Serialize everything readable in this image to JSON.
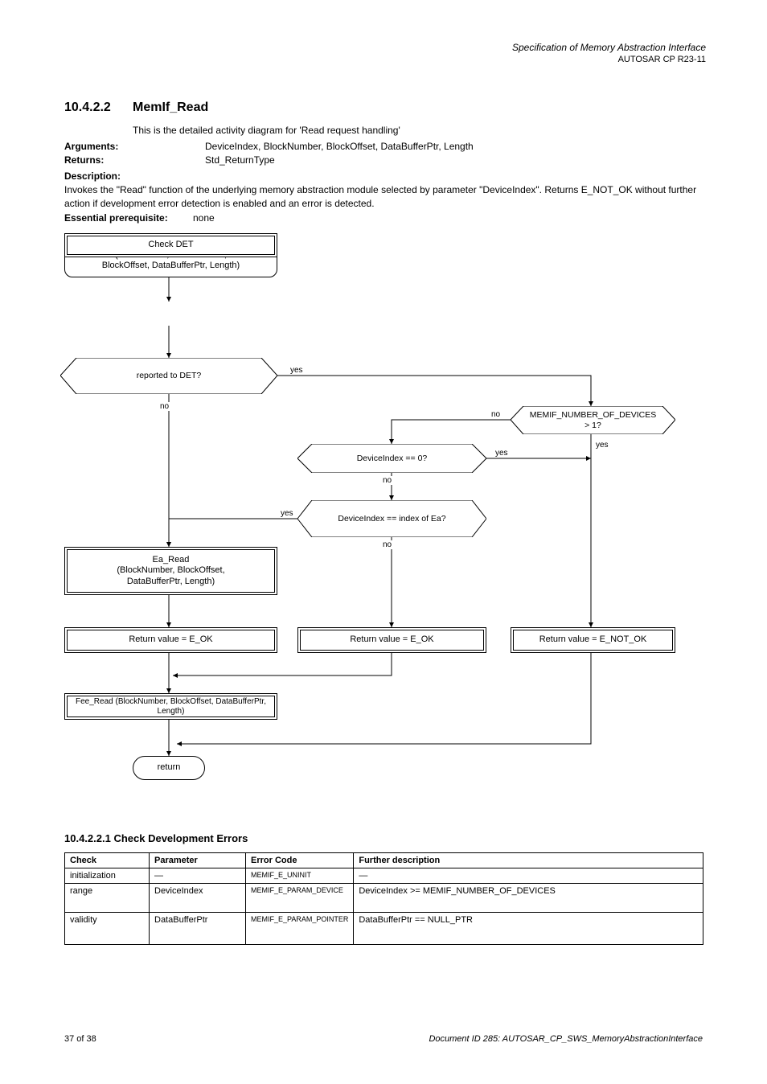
{
  "header": {
    "line1": "Specification of Memory Abstraction Interface",
    "line2": "AUTOSAR CP R23-11"
  },
  "section": {
    "number": "10.4.2.2",
    "title": "MemIf_Read",
    "callout": "This is the detailed activity diagram for 'Read request handling'",
    "args_label": "Arguments:",
    "args": "DeviceIndex, BlockNumber, BlockOffset, DataBufferPtr, Length",
    "returns_label": "Returns:",
    "returns": "Std_ReturnType",
    "desc_label": "Description:",
    "desc_text": "Invokes the \"Read\" function of the underlying memory abstraction module selected by parameter \"DeviceIndex\". Returns E_NOT_OK without further action if development error detection is enabled and an error is detected.",
    "prereq_label": "Essential prerequisite:",
    "prereq_val": "none"
  },
  "flow": {
    "start": "MemIf_Read\n(DeviceIndex, BlockNumber,\nBlockOffset, DataBufferPtr, Length)",
    "chk_det": "Check DET",
    "dec_reported": "reported to DET?",
    "dec_devices": "MEMIF_NUMBER_OF_DEVICES > 1?",
    "dec_deviceindex": "DeviceIndex == 0?",
    "dec_equal_index": "DeviceIndex == index of Ea?",
    "ea_read": "Ea_Read\n(BlockNumber, BlockOffset,\nDataBufferPtr, Length)",
    "eok_left": "Return value = E_OK",
    "eok_mid": "Return value = E_OK",
    "enok": "Return value = E_NOT_OK",
    "fee_read": "Fee_Read\n(BlockNumber, BlockOffset, DataBufferPtr, Length)",
    "return": "return",
    "labels": {
      "no": "no",
      "yes": "yes",
      "no2": "no",
      "yes2": "yes",
      "no3": "no",
      "yes3": "yes",
      "no4": "no",
      "yes4": "yes"
    }
  },
  "errors": {
    "heading": "10.4.2.2.1 Check Development Errors",
    "cols": [
      "Check",
      "Parameter",
      "Error Code",
      "Further description"
    ],
    "rows": [
      [
        "initialization",
        "—",
        "MEMIF_E_UNINIT",
        "—"
      ],
      [
        "range",
        "DeviceIndex",
        "MEMIF_E_PARAM_DEVICE",
        "DeviceIndex >= MEMIF_NUMBER_OF_DEVICES"
      ],
      [
        "validity",
        "DataBufferPtr",
        "MEMIF_E_PARAM_POINTER",
        "DataBufferPtr == NULL_PTR"
      ]
    ]
  },
  "footer": {
    "page": "37 of 38",
    "doc": "Document ID 285: AUTOSAR_CP_SWS_MemoryAbstractionInterface"
  }
}
